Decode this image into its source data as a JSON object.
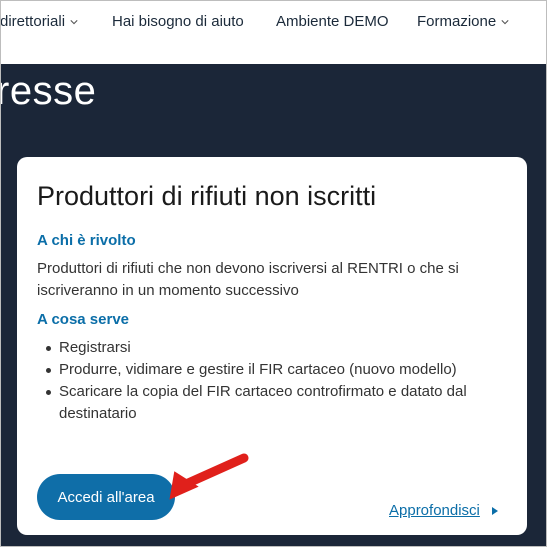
{
  "nav": {
    "items": [
      {
        "label": "direttoriali",
        "has_menu": true
      },
      {
        "label": "Hai bisogno di aiuto",
        "has_menu": false
      },
      {
        "label": "Ambiente DEMO",
        "has_menu": false
      },
      {
        "label": "Formazione",
        "has_menu": true
      }
    ]
  },
  "hero": {
    "title": "resse"
  },
  "card": {
    "title": "Produttori di rifiuti non iscritti",
    "who_label": "A chi è rivolto",
    "who_text": "Produttori di rifiuti che non devono iscriversi al RENTRI o che si iscriveranno in un momento successivo",
    "what_label": "A cosa serve",
    "uses": [
      "Registrarsi",
      "Produrre, vidimare e gestire il FIR cartaceo (nuovo modello)",
      "Scaricare la copia del FIR cartaceo controfirmato e datato dal destinatario"
    ],
    "button_label": "Accedi all'area",
    "link_label": "Approfondisci"
  },
  "colors": {
    "hero_bg": "#1b2638",
    "accent": "#0f6ea8",
    "annotation": "#e0201b"
  }
}
